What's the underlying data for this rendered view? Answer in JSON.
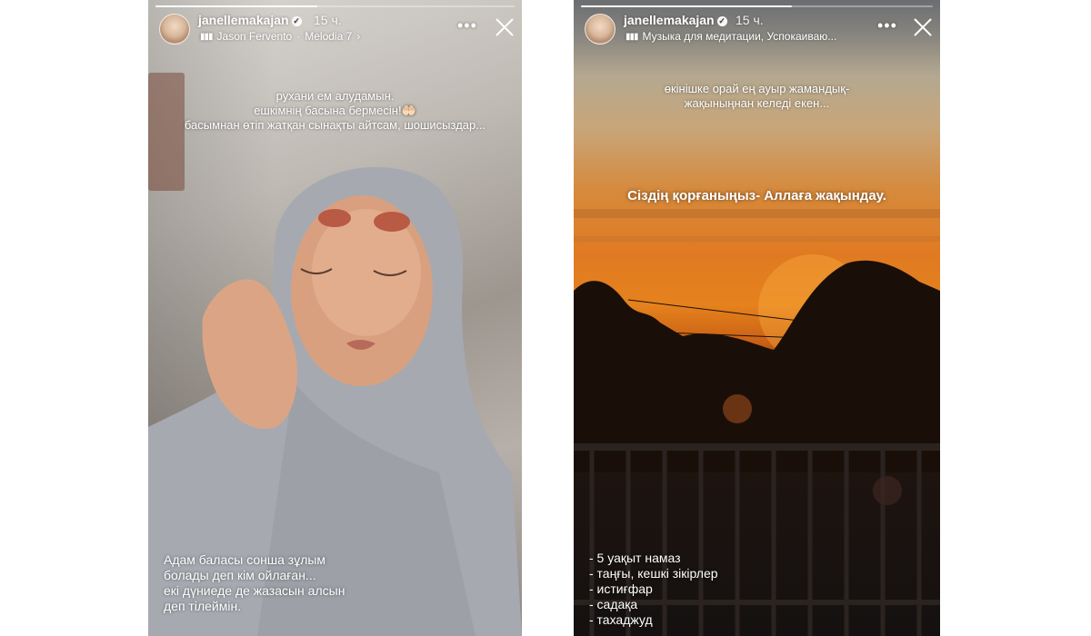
{
  "stories": [
    {
      "username": "janellemakajan",
      "time": "15 ч.",
      "music_artist": "Jason Fervento",
      "music_track": "Melodia 7",
      "music_chevron": "›",
      "more_label": "•••",
      "caption_top": [
        "рухани ем алудамын.",
        "ешкімнің басына бермесін!🤲🏻",
        "басымнан өтіп жатқан сынақты айтсам, шошисыздар..."
      ],
      "caption_bottom": [
        "Адам баласы сонша зұлым",
        "болады деп кім ойлаған...",
        "екі дүниеде де жазасын алсын",
        "деп тілеймін."
      ],
      "icons": {
        "avatar": "avatar",
        "verified": "verified-icon",
        "music": "music-icon",
        "more": "more-icon",
        "close": "close-icon"
      }
    },
    {
      "username": "janellemakajan",
      "time": "15 ч.",
      "music_text": "Музыка для медитации, Успокаиваю...",
      "more_label": "•••",
      "caption_top": [
        "өкінішке орай ең ауыр жамандық-",
        "жақыныңнан келеді екен..."
      ],
      "caption_middle": "Сіздің қорғаныңыз- Аллаға жақындау.",
      "caption_list": [
        "- 5 уақыт намаз",
        "- таңғы, кешкі зікірлер",
        "- истиғфар",
        "- садақа",
        "- тахаджуд"
      ],
      "icons": {
        "avatar": "avatar",
        "verified": "verified-icon",
        "music": "music-icon",
        "more": "more-icon",
        "close": "close-icon"
      }
    }
  ],
  "colors": {
    "sky_orange": "#e07a22",
    "sun": "#fff4d0",
    "hijab_grey": "#a9acb3",
    "text": "#ffffff"
  }
}
